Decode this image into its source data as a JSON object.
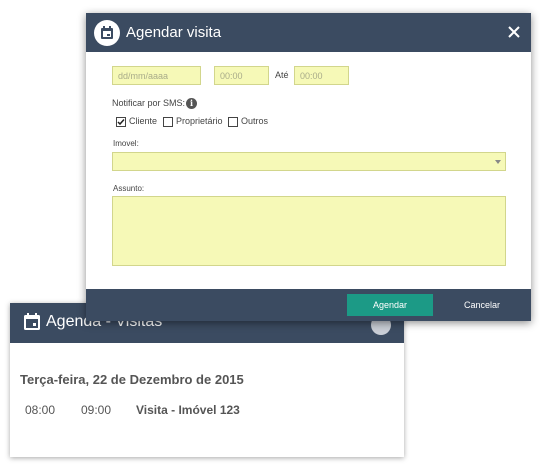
{
  "agenda": {
    "title": "Agenda - Visitas",
    "date": "Terça-feira, 22 de Dezembro de 2015",
    "events": [
      {
        "start": "08:00",
        "end": "09:00",
        "title": "Visita - Imóvel 123"
      }
    ]
  },
  "modal": {
    "title": "Agendar visita",
    "fields": {
      "date_placeholder": "dd/mm/aaaa",
      "time_from_placeholder": "00:00",
      "until_label": "Até",
      "time_to_placeholder": "00:00"
    },
    "sms": {
      "label": "Notificar por SMS:",
      "options": [
        {
          "label": "Cliente",
          "checked": true
        },
        {
          "label": "Proprietário",
          "checked": false
        },
        {
          "label": "Outros",
          "checked": false
        }
      ]
    },
    "imovel": {
      "label": "Imovel:",
      "value": ""
    },
    "assunto": {
      "label": "Assunto:",
      "value": ""
    },
    "buttons": {
      "submit": "Agendar",
      "cancel": "Cancelar"
    }
  },
  "colors": {
    "header_bg": "#3b4b61",
    "field_bg": "#f6f9b7",
    "primary_button": "#1c9a86"
  },
  "icons": {
    "calendar": "calendar-icon",
    "close": "close-icon",
    "info": "info-icon",
    "add": "add-icon",
    "dropdown": "chevron-down-icon"
  }
}
